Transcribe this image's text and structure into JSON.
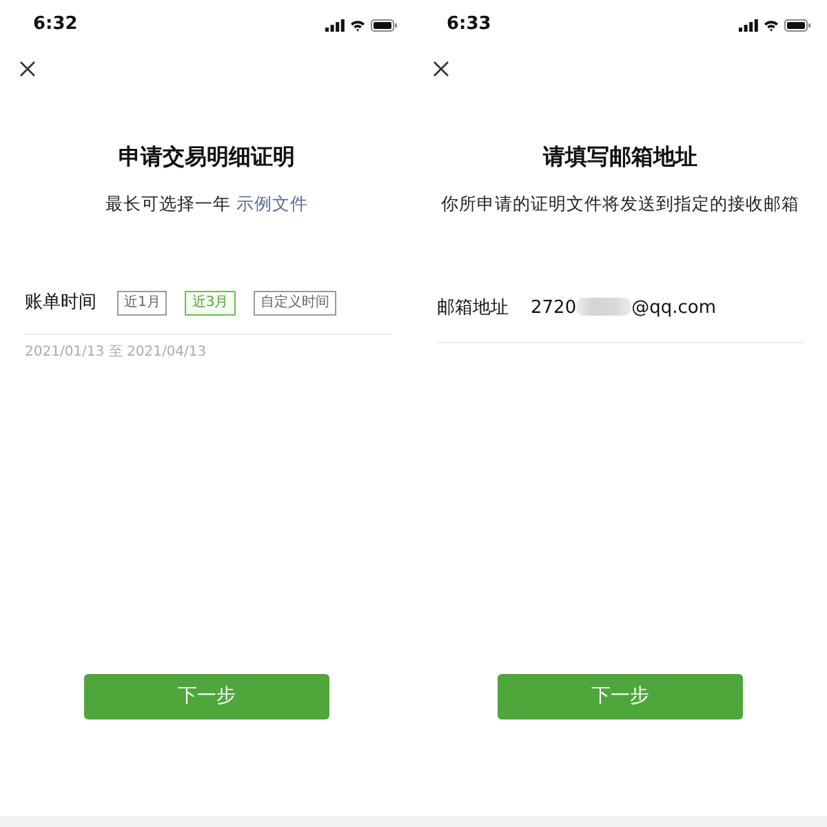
{
  "screens": [
    {
      "status_bar": {
        "time": "6:32"
      },
      "title": "申请交易明细证明",
      "subtitle": "最长可选择一年",
      "subtitle_link": "示例文件",
      "form": {
        "kind": "date_range",
        "label": "账单时间",
        "options": [
          {
            "label": "近1月",
            "selected": false
          },
          {
            "label": "近3月",
            "selected": true
          },
          {
            "label": "自定义时间",
            "selected": false
          }
        ],
        "range": "2021/01/13 至 2021/04/13"
      },
      "button": "下一步"
    },
    {
      "status_bar": {
        "time": "6:33"
      },
      "title": "请填写邮箱地址",
      "subtitle": "你所申请的证明文件将发送到指定的接收邮箱",
      "form": {
        "kind": "email",
        "label": "邮箱地址",
        "value_start": "2720",
        "value_end": "@qq.com",
        "redacted": true
      },
      "button": "下一步"
    }
  ]
}
